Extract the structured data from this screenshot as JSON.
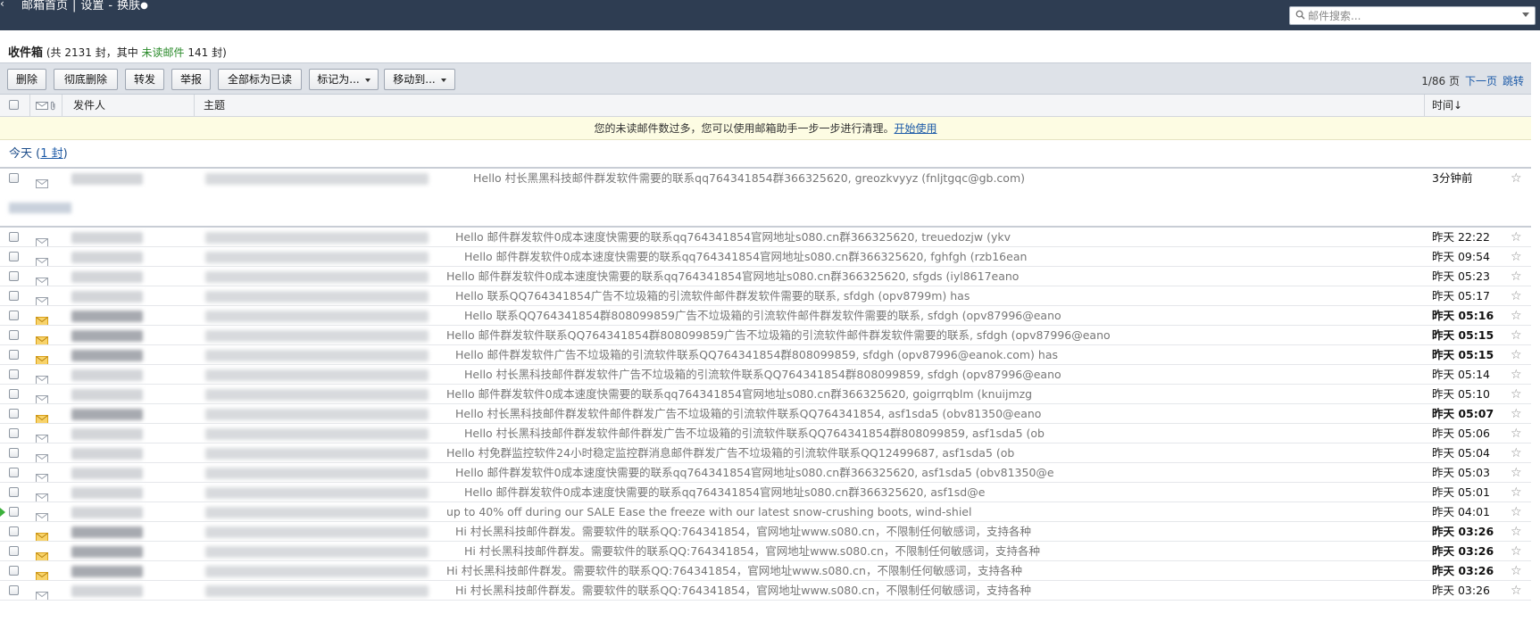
{
  "topbar": {
    "back": "‹",
    "link1": "邮箱首页",
    "link2": "设置",
    "link3": "换肤"
  },
  "search": {
    "placeholder": "邮件搜索..."
  },
  "inbox": {
    "title": "收件箱",
    "summary_prefix": "(共 2131 封，其中 ",
    "unread_label": "未读邮件",
    "summary_suffix": " 141 封)"
  },
  "toolbar": {
    "delete": "删除",
    "purge": "彻底删除",
    "forward": "转发",
    "report": "举报",
    "mark_all_read": "全部标为已读",
    "mark_as": "标记为...",
    "move_to": "移动到...",
    "page_info": "1/86 页",
    "next_page": "下一页",
    "jump": "跳转"
  },
  "columns": {
    "sender": "发件人",
    "subject": "主题",
    "time": "时间↓"
  },
  "notice": {
    "text": "您的未读邮件数过多，您可以使用邮箱助手一步一步进行清理。",
    "link": "开始使用"
  },
  "group_today": {
    "label": "今天",
    "count": "1 封"
  },
  "rows": [
    {
      "subject": "Hello 村长黑黑科技邮件群发软件需要的联系qq764341854群366325620, greozkvyyz (fnljtgqc@gb.com)",
      "time": "3分钟前",
      "unread": false
    },
    {
      "subject": "Hello 邮件群发软件0成本速度快需要的联系qq764341854官网地址s080.cn群366325620, treuedozjw (ykv",
      "time": "昨天 22:22",
      "unread": false
    },
    {
      "subject": "Hello 邮件群发软件0成本速度快需要的联系qq764341854官网地址s080.cn群366325620, fghfgh (rzb16ean",
      "time": "昨天 09:54",
      "unread": false
    },
    {
      "subject": "Hello 邮件群发软件0成本速度快需要的联系qq764341854官网地址s080.cn群366325620, sfgds (iyl8617eano",
      "time": "昨天 05:23",
      "unread": false
    },
    {
      "subject": "Hello 联系QQ764341854广告不垃圾箱的引流软件邮件群发软件需要的联系, sfdgh (opv8799m) has",
      "time": "昨天 05:17",
      "unread": false
    },
    {
      "subject": "Hello 联系QQ764341854群808099859广告不垃圾箱的引流软件邮件群发软件需要的联系, sfdgh (opv87996@eano",
      "time": "昨天 05:16",
      "unread": true
    },
    {
      "subject": "Hello 邮件群发软件联系QQ764341854群808099859广告不垃圾箱的引流软件邮件群发软件需要的联系, sfdgh (opv87996@eano",
      "time": "昨天 05:15",
      "unread": true
    },
    {
      "subject": "Hello 邮件群发软件广告不垃圾箱的引流软件联系QQ764341854群808099859, sfdgh (opv87996@eanok.com) has",
      "time": "昨天 05:15",
      "unread": true
    },
    {
      "subject": "Hello 村长黑科技邮件群发软件广告不垃圾箱的引流软件联系QQ764341854群808099859, sfdgh (opv87996@eano",
      "time": "昨天 05:14",
      "unread": false
    },
    {
      "subject": "Hello 邮件群发软件0成本速度快需要的联系qq764341854官网地址s080.cn群366325620, goigrrqblm (knuijmzg",
      "time": "昨天 05:10",
      "unread": false
    },
    {
      "subject": "Hello 村长黑科技邮件群发软件邮件群发广告不垃圾箱的引流软件联系QQ764341854, asf1sda5 (obv81350@eano",
      "time": "昨天 05:07",
      "unread": true
    },
    {
      "subject": "Hello 村长黑科技邮件群发软件邮件群发广告不垃圾箱的引流软件联系QQ764341854群808099859, asf1sda5 (ob",
      "time": "昨天 05:06",
      "unread": false
    },
    {
      "subject": "Hello 村免群监控软件24小时稳定监控群消息邮件群发广告不垃圾箱的引流软件联系QQ12499687, asf1sda5 (ob",
      "time": "昨天 05:04",
      "unread": false
    },
    {
      "subject": "Hello 邮件群发软件0成本速度快需要的联系qq764341854官网地址s080.cn群366325620, asf1sda5 (obv81350@e",
      "time": "昨天 05:03",
      "unread": false
    },
    {
      "subject": "Hello 邮件群发软件0成本速度快需要的联系qq764341854官网地址s080.cn群366325620, asf1sd@e",
      "time": "昨天 05:01",
      "unread": false
    },
    {
      "subject": "up to 40% off during our SALE Ease the freeze with our latest snow-crushing boots, wind-shiel",
      "time": "昨天 04:01",
      "unread": false
    },
    {
      "subject": "Hi 村长黑科技邮件群发。需要软件的联系QQ:764341854，官网地址www.s080.cn，不限制任何敏感词，支持各种",
      "time": "昨天 03:26",
      "unread": true
    },
    {
      "subject": "Hi 村长黑科技邮件群发。需要软件的联系QQ:764341854，官网地址www.s080.cn，不限制任何敏感词，支持各种",
      "time": "昨天 03:26",
      "unread": true
    },
    {
      "subject": "Hi 村长黑科技邮件群发。需要软件的联系QQ:764341854，官网地址www.s080.cn，不限制任何敏感词，支持各种",
      "time": "昨天 03:26",
      "unread": true
    },
    {
      "subject": "Hi 村长黑科技邮件群发。需要软件的联系QQ:764341854，官网地址www.s080.cn，不限制任何敏感词，支持各种",
      "time": "昨天 03:26",
      "unread": false
    }
  ],
  "icons": {
    "star": "☆",
    "accent": "#2e3d52",
    "unread_envelope": "#f3b62c",
    "read_envelope": "#9aa1ab"
  }
}
